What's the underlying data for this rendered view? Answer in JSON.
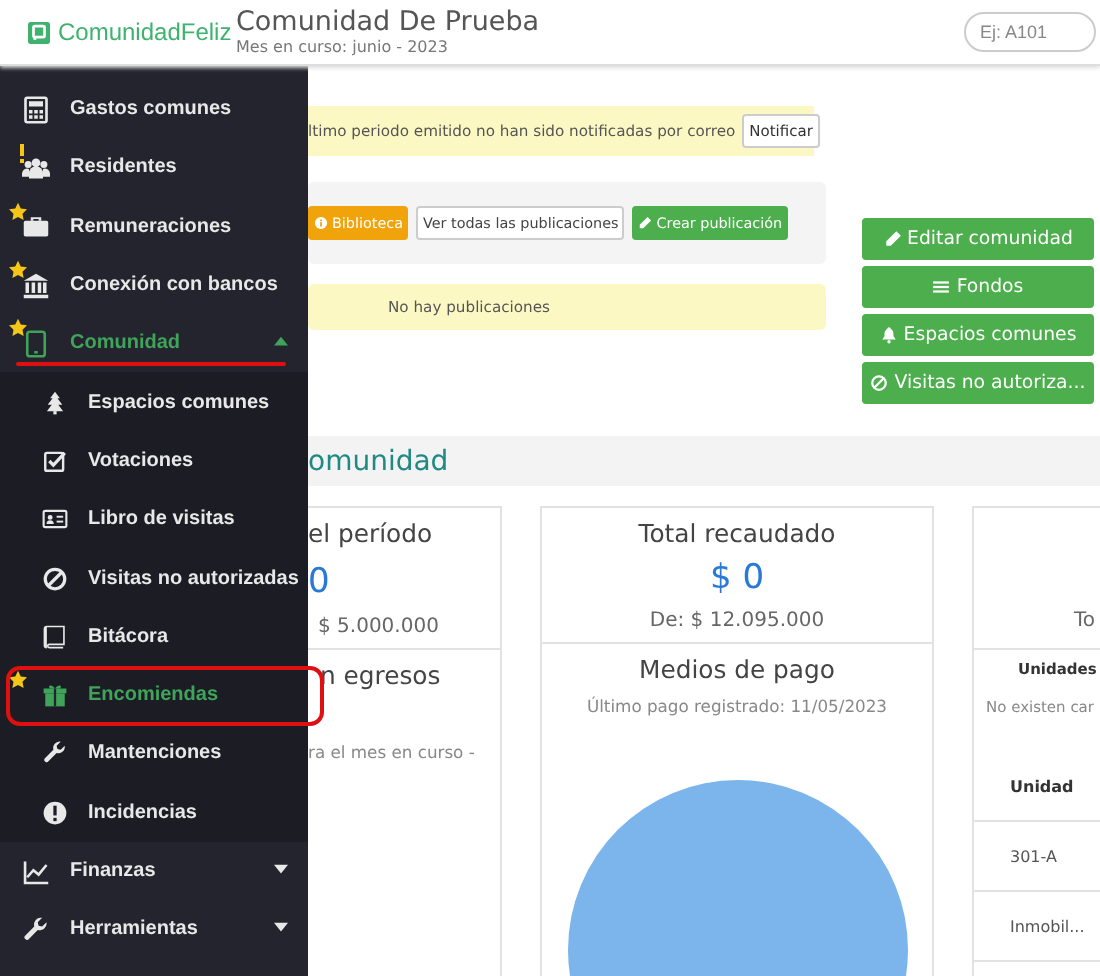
{
  "header": {
    "logo": "ComunidadFeliz",
    "title": "Comunidad De Prueba",
    "subtitle": "Mes en curso: junio - 2023",
    "search": {
      "placeholder": "Ej: A101"
    }
  },
  "sidebar": {
    "items": [
      {
        "label": "Gastos comunes",
        "selected": false
      },
      {
        "label": "Residentes",
        "selected": false,
        "alert": true
      },
      {
        "label": "Remuneraciones",
        "selected": false,
        "starred": true
      },
      {
        "label": "Conexión con bancos",
        "selected": false,
        "starred": true
      },
      {
        "label": "Comunidad",
        "selected": true,
        "starred": true,
        "expanded": true,
        "underlined": true,
        "children": [
          {
            "label": "Espacios comunes",
            "selected": false
          },
          {
            "label": "Votaciones",
            "selected": false
          },
          {
            "label": "Libro de visitas",
            "selected": false
          },
          {
            "label": "Visitas no autorizadas",
            "selected": false
          },
          {
            "label": "Bitácora",
            "selected": false
          },
          {
            "label": "Encomiendas",
            "selected": true,
            "starred": true,
            "boxed": true
          },
          {
            "label": "Mantenciones",
            "selected": false
          },
          {
            "label": "Incidencias",
            "selected": false
          }
        ]
      },
      {
        "label": "Finanzas",
        "selected": false,
        "expanded": false
      },
      {
        "label": "Herramientas",
        "selected": false,
        "expanded": false
      }
    ]
  },
  "notice": {
    "text": "ltimo periodo emitido no han sido notificadas por correo",
    "button": "Notificar"
  },
  "publications": {
    "buttons": [
      {
        "label": "Biblioteca",
        "kind": "warning"
      },
      {
        "label": "Ver todas las publicaciones",
        "kind": "plain"
      },
      {
        "label": "Crear publicación",
        "kind": "success"
      }
    ],
    "empty": "No hay publicaciones"
  },
  "actions": [
    {
      "label": "Editar comunidad"
    },
    {
      "label": "Fondos"
    },
    {
      "label": "Espacios comunes"
    },
    {
      "label": "Visitas no autoriza..."
    }
  ],
  "section_title": "omunidad",
  "cards": [
    {
      "kind": "summary",
      "title": "el período",
      "amount": "0",
      "detail": "$ 5.000.000",
      "subtitle": "n egresos",
      "note": "ra el mes en curso -"
    },
    {
      "kind": "chart",
      "title": "Total recaudado",
      "amount": "$ 0",
      "detail": "De: $ 12.095.000",
      "subtitle": "Medios de pago",
      "note": "Último pago registrado: 11/05/2023"
    },
    {
      "kind": "table",
      "detail": "To",
      "subtitle": "Unidades",
      "note": "No existen car",
      "table": {
        "columns": [
          "Unidad"
        ],
        "rows": [
          [
            "301-A"
          ],
          [
            "Inmobil..."
          ]
        ]
      }
    }
  ]
}
